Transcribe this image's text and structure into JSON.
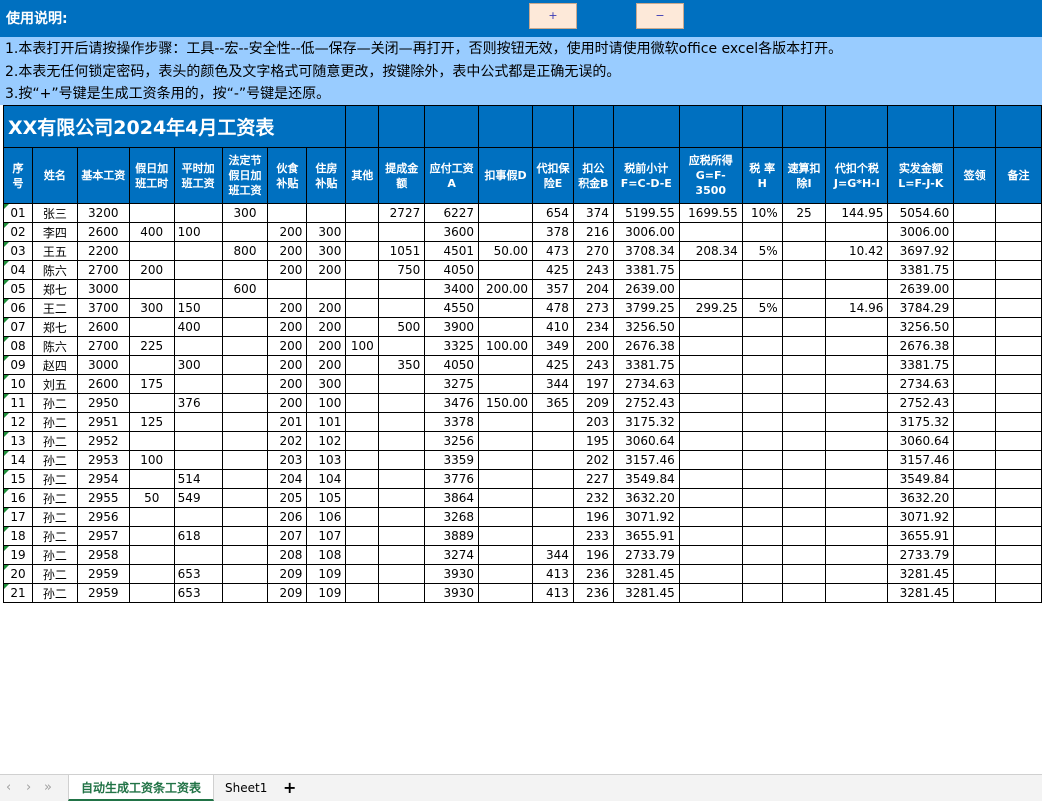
{
  "header": {
    "title": "使用说明:",
    "plus_button": "+",
    "minus_button": "−"
  },
  "notes": [
    "1.本表打开后请按操作步骤：工具--宏--安全性--低—保存—关闭—再打开，否则按钮无效，使用时请使用微软office excel各版本打开。",
    "2.本表无任何锁定密码，表头的颜色及文字格式可随意更改，按键除外，表中公式都是正确无误的。",
    "3.按“+”号键是生成工资条用的，按“-”号键是还原。"
  ],
  "sheet_title": "XX有限公司2024年4月工资表",
  "columns": [
    "序号",
    "姓名",
    "基本工资",
    "假日加班工时",
    "平时加班工资",
    "法定节假日加班工资",
    "伙食补贴",
    "住房补贴",
    "其他",
    "提成金额",
    "应付工资A",
    "扣事假D",
    "代扣保险E",
    "扣公积金B",
    "税前小计F=C-D-E",
    "应税所得G=F-3500",
    "税 率H",
    "速算扣除I",
    "代扣个税J=G*H-I",
    "实发金额L=F-J-K",
    "签领",
    "备注"
  ],
  "rows": [
    [
      "01",
      "张三",
      "3200",
      "",
      "",
      "300",
      "",
      "",
      "",
      "2727",
      "6227",
      "",
      "654",
      "374",
      "5199.55",
      "1699.55",
      "10%",
      "25",
      "144.95",
      "5054.60",
      "",
      ""
    ],
    [
      "02",
      "李四",
      "2600",
      "400",
      "100",
      "",
      "200",
      "300",
      "",
      "",
      "3600",
      "",
      "378",
      "216",
      "3006.00",
      "",
      "",
      "",
      "",
      "3006.00",
      "",
      ""
    ],
    [
      "03",
      "王五",
      "2200",
      "",
      "",
      "800",
      "200",
      "300",
      "",
      "1051",
      "4501",
      "50.00",
      "473",
      "270",
      "3708.34",
      "208.34",
      "5%",
      "",
      "10.42",
      "3697.92",
      "",
      ""
    ],
    [
      "04",
      "陈六",
      "2700",
      "200",
      "",
      "",
      "200",
      "200",
      "",
      "750",
      "4050",
      "",
      "425",
      "243",
      "3381.75",
      "",
      "",
      "",
      "",
      "3381.75",
      "",
      ""
    ],
    [
      "05",
      "郑七",
      "3000",
      "",
      "",
      "600",
      "",
      "",
      "",
      "",
      "3400",
      "200.00",
      "357",
      "204",
      "2639.00",
      "",
      "",
      "",
      "",
      "2639.00",
      "",
      ""
    ],
    [
      "06",
      "王二",
      "3700",
      "300",
      "150",
      "",
      "200",
      "200",
      "",
      "",
      "4550",
      "",
      "478",
      "273",
      "3799.25",
      "299.25",
      "5%",
      "",
      "14.96",
      "3784.29",
      "",
      ""
    ],
    [
      "07",
      "郑七",
      "2600",
      "",
      "400",
      "",
      "200",
      "200",
      "",
      "500",
      "3900",
      "",
      "410",
      "234",
      "3256.50",
      "",
      "",
      "",
      "",
      "3256.50",
      "",
      ""
    ],
    [
      "08",
      "陈六",
      "2700",
      "225",
      "",
      "",
      "200",
      "200",
      "100",
      "",
      "3325",
      "100.00",
      "349",
      "200",
      "2676.38",
      "",
      "",
      "",
      "",
      "2676.38",
      "",
      ""
    ],
    [
      "09",
      "赵四",
      "3000",
      "",
      "300",
      "",
      "200",
      "200",
      "",
      "350",
      "4050",
      "",
      "425",
      "243",
      "3381.75",
      "",
      "",
      "",
      "",
      "3381.75",
      "",
      ""
    ],
    [
      "10",
      "刘五",
      "2600",
      "175",
      "",
      "",
      "200",
      "300",
      "",
      "",
      "3275",
      "",
      "344",
      "197",
      "2734.63",
      "",
      "",
      "",
      "",
      "2734.63",
      "",
      ""
    ],
    [
      "11",
      "孙二",
      "2950",
      "",
      "376",
      "",
      "200",
      "100",
      "",
      "",
      "3476",
      "150.00",
      "365",
      "209",
      "2752.43",
      "",
      "",
      "",
      "",
      "2752.43",
      "",
      ""
    ],
    [
      "12",
      "孙二",
      "2951",
      "125",
      "",
      "",
      "201",
      "101",
      "",
      "",
      "3378",
      "",
      "",
      "203",
      "3175.32",
      "",
      "",
      "",
      "",
      "3175.32",
      "",
      ""
    ],
    [
      "13",
      "孙二",
      "2952",
      "",
      "",
      "",
      "202",
      "102",
      "",
      "",
      "3256",
      "",
      "",
      "195",
      "3060.64",
      "",
      "",
      "",
      "",
      "3060.64",
      "",
      ""
    ],
    [
      "14",
      "孙二",
      "2953",
      "100",
      "",
      "",
      "203",
      "103",
      "",
      "",
      "3359",
      "",
      "",
      "202",
      "3157.46",
      "",
      "",
      "",
      "",
      "3157.46",
      "",
      ""
    ],
    [
      "15",
      "孙二",
      "2954",
      "",
      "514",
      "",
      "204",
      "104",
      "",
      "",
      "3776",
      "",
      "",
      "227",
      "3549.84",
      "",
      "",
      "",
      "",
      "3549.84",
      "",
      ""
    ],
    [
      "16",
      "孙二",
      "2955",
      "50",
      "549",
      "",
      "205",
      "105",
      "",
      "",
      "3864",
      "",
      "",
      "232",
      "3632.20",
      "",
      "",
      "",
      "",
      "3632.20",
      "",
      ""
    ],
    [
      "17",
      "孙二",
      "2956",
      "",
      "",
      "",
      "206",
      "106",
      "",
      "",
      "3268",
      "",
      "",
      "196",
      "3071.92",
      "",
      "",
      "",
      "",
      "3071.92",
      "",
      ""
    ],
    [
      "18",
      "孙二",
      "2957",
      "",
      "618",
      "",
      "207",
      "107",
      "",
      "",
      "3889",
      "",
      "",
      "233",
      "3655.91",
      "",
      "",
      "",
      "",
      "3655.91",
      "",
      ""
    ],
    [
      "19",
      "孙二",
      "2958",
      "",
      "",
      "",
      "208",
      "108",
      "",
      "",
      "3274",
      "",
      "344",
      "196",
      "2733.79",
      "",
      "",
      "",
      "",
      "2733.79",
      "",
      ""
    ],
    [
      "20",
      "孙二",
      "2959",
      "",
      "653",
      "",
      "209",
      "109",
      "",
      "",
      "3930",
      "",
      "413",
      "236",
      "3281.45",
      "",
      "",
      "",
      "",
      "3281.45",
      "",
      ""
    ],
    [
      "21",
      "孙二",
      "2959",
      "",
      "653",
      "",
      "209",
      "109",
      "",
      "",
      "3930",
      "",
      "413",
      "236",
      "3281.45",
      "",
      "",
      "",
      "",
      "3281.45",
      "",
      ""
    ]
  ],
  "tabs": {
    "nav_first": "‹",
    "nav_prev": "›",
    "nav_last": "»",
    "active": "自动生成工资条工资表",
    "second": "Sheet1",
    "add": "+"
  },
  "colors": {
    "header_blue": "#0070c0",
    "notes_bg": "#99ccff",
    "button_bg": "#fde9d9",
    "tab_active": "#217346"
  }
}
